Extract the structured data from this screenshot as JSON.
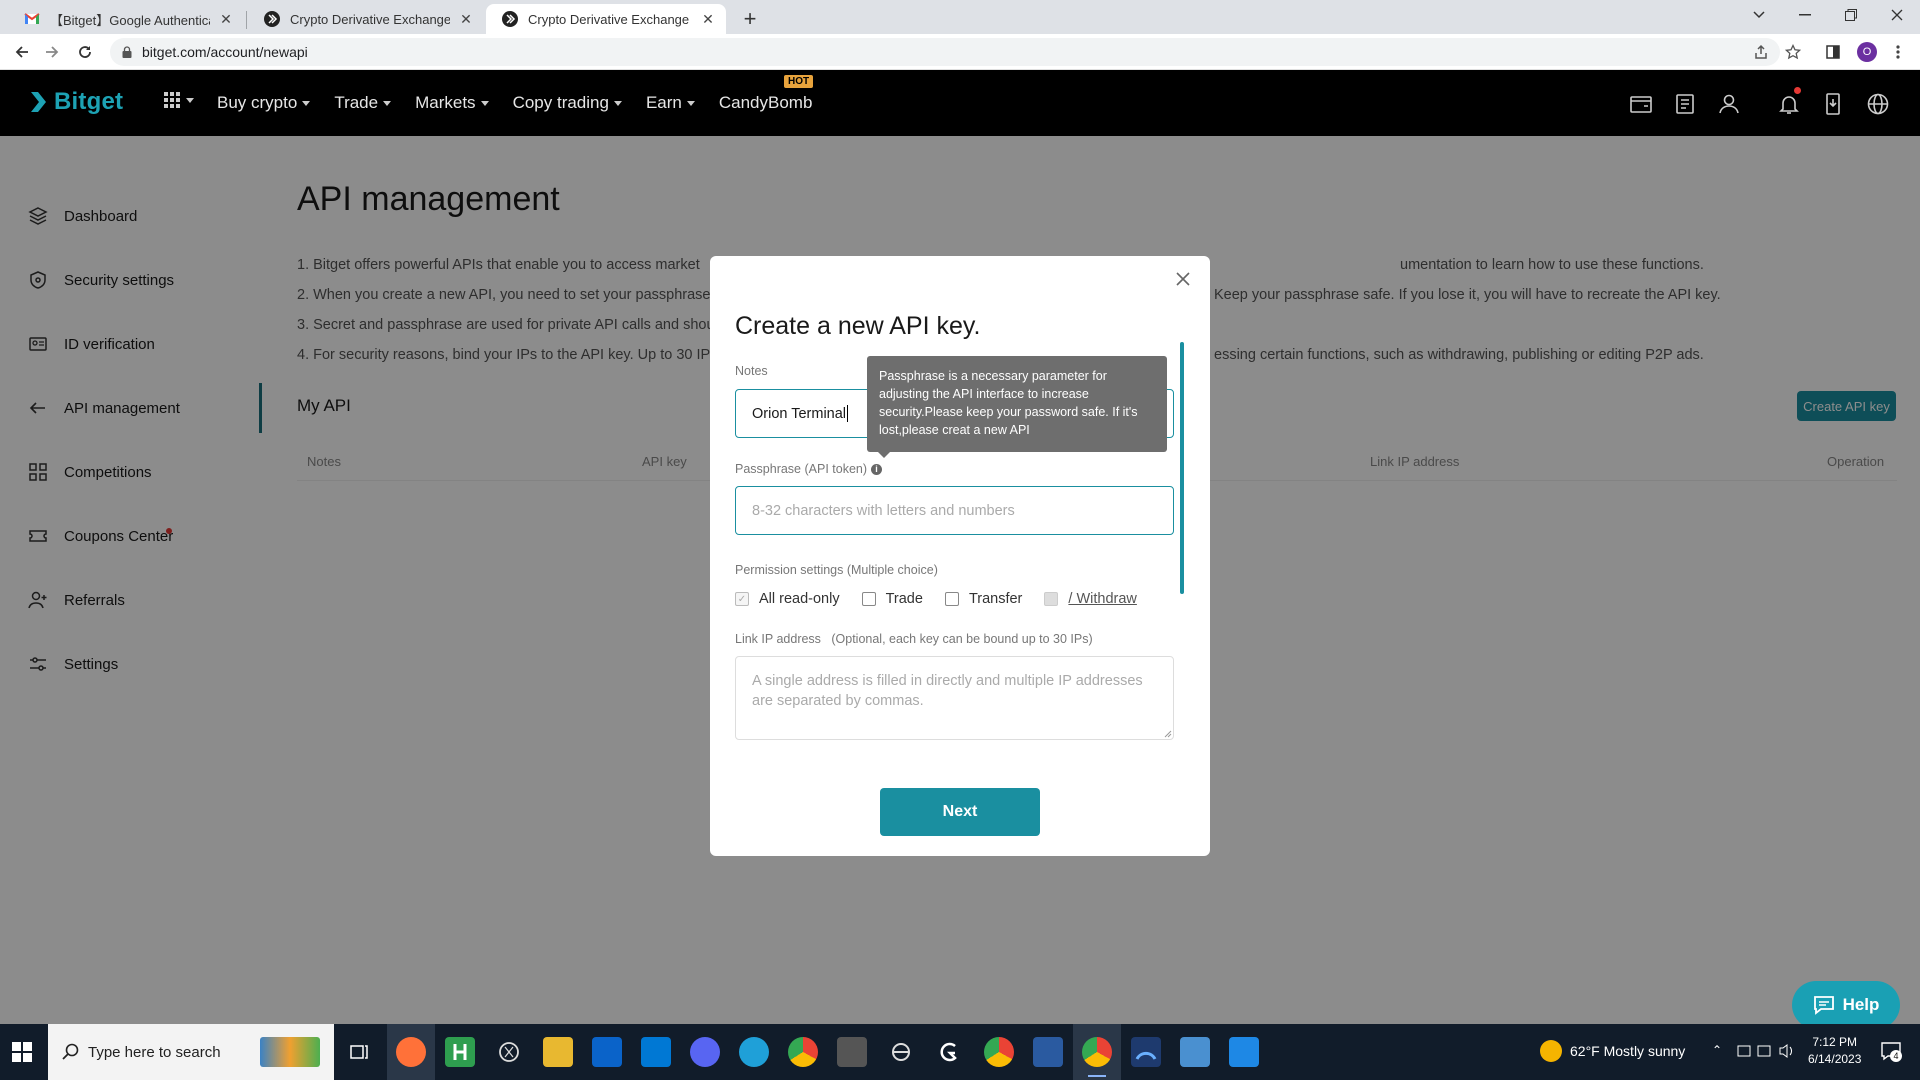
{
  "browser": {
    "tabs": [
      {
        "title": "【Bitget】Google Authenticator bi",
        "favicon": "gmail-icon"
      },
      {
        "title": "Crypto Derivative Exchange | Bitg",
        "favicon": "bitget-icon"
      },
      {
        "title": "Crypto Derivative Exchange | Bitg",
        "favicon": "bitget-icon",
        "active": true
      }
    ],
    "url": "bitget.com/account/newapi",
    "profile_initial": "O"
  },
  "site": {
    "logo": "Bitget",
    "nav": [
      "Buy crypto",
      "Trade",
      "Markets",
      "Copy trading",
      "Earn",
      "CandyBomb"
    ],
    "hot_badge": "HOT"
  },
  "sidebar": {
    "items": [
      {
        "label": "Dashboard",
        "icon": "layers-icon"
      },
      {
        "label": "Security settings",
        "icon": "shield-icon"
      },
      {
        "label": "ID verification",
        "icon": "id-card-icon"
      },
      {
        "label": "API management",
        "icon": "api-icon"
      },
      {
        "label": "Competitions",
        "icon": "grid-icon"
      },
      {
        "label": "Coupons Center",
        "icon": "coupon-icon"
      },
      {
        "label": "Referrals",
        "icon": "user-add-icon"
      },
      {
        "label": "Settings",
        "icon": "settings-icon"
      }
    ]
  },
  "page": {
    "title": "API management",
    "notes": [
      "1. Bitget offers powerful APIs that enable you to access market",
      "2. When you create a new API, you need to set your passphrase",
      "3. Secret and passphrase are used for private API calls and shou",
      "4. For security reasons, bind your IPs to the API key. Up to 30 IP"
    ],
    "notes_right": [
      "umentation to learn how to use these functions.",
      "Keep your passphrase safe. If you lose it, you will have to recreate the API key.",
      "",
      "essing certain functions, such as withdrawing, publishing or editing P2P ads."
    ],
    "my_api": "My API",
    "create_button": "Create API key",
    "table_headers": [
      "Notes",
      "API key",
      "Link IP address",
      "Operation"
    ]
  },
  "modal": {
    "title": "Create a new API key.",
    "notes_label": "Notes",
    "notes_value": "Orion Terminal",
    "passphrase_label": "Passphrase (API token)",
    "passphrase_placeholder": "8-32 characters with letters and numbers",
    "tooltip": "Passphrase is a necessary parameter for adjusting the API interface to increase security.Please keep your password safe. If it's lost,please creat a new API",
    "permission_label": "Permission settings (Multiple choice)",
    "permissions": [
      {
        "label": "All read-only",
        "checked": true,
        "disabled": true
      },
      {
        "label": "Trade",
        "checked": false
      },
      {
        "label": "Transfer",
        "checked": false
      },
      {
        "label": "/ Withdraw",
        "checked": false,
        "disabled": true
      }
    ],
    "ip_label": "Link IP address",
    "ip_hint": "(Optional, each key can be bound up to 30 IPs)",
    "ip_placeholder": "A single address is filled in directly and multiple IP addresses are separated by commas.",
    "next_button": "Next"
  },
  "help": {
    "label": "Help"
  },
  "taskbar": {
    "search_placeholder": "Type here to search",
    "weather": "62°F  Mostly sunny",
    "time": "7:12 PM",
    "date": "6/14/2023",
    "notification_count": "4"
  },
  "colors": {
    "accent": "#1a8fa0",
    "header_bg": "#000000",
    "tooltip_bg": "#6e6e6e"
  }
}
